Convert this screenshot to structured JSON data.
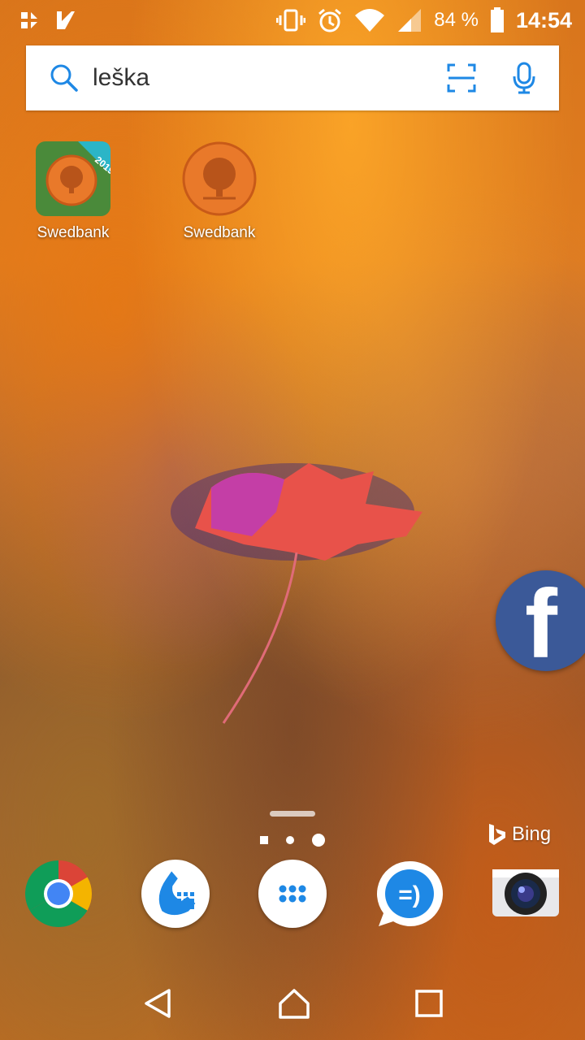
{
  "status_bar": {
    "battery_percent": "84 %",
    "time": "14:54"
  },
  "search": {
    "query": "leška"
  },
  "home_apps": [
    {
      "label": "Swedbank",
      "badge": "2019"
    },
    {
      "label": "Swedbank"
    }
  ],
  "bing": {
    "label": "Bing"
  },
  "dock": [
    {
      "icon": "chrome-icon"
    },
    {
      "icon": "phone-icon"
    },
    {
      "icon": "app-drawer-icon"
    },
    {
      "icon": "messages-icon"
    },
    {
      "icon": "camera-icon"
    }
  ],
  "colors": {
    "accent": "#1e88e5",
    "facebook": "#3b5998",
    "swedbank_orange": "#e9792a"
  }
}
